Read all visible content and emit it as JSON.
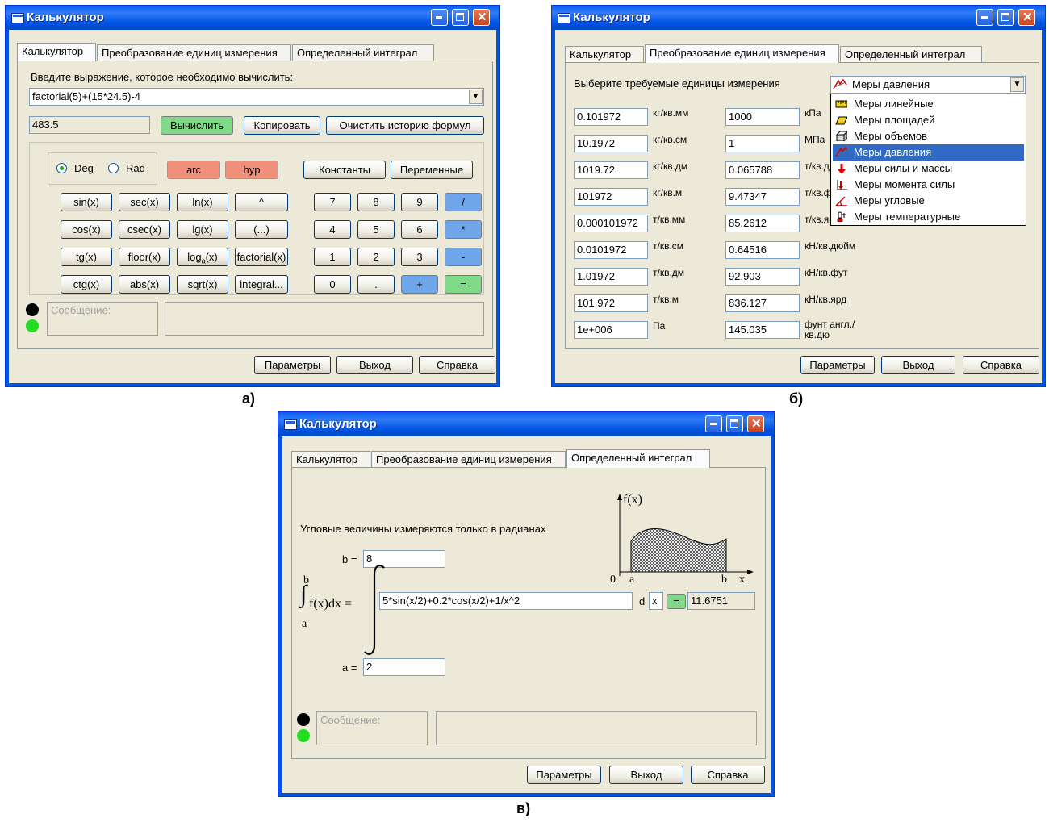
{
  "common": {
    "title": "Калькулятор",
    "tabs": [
      "Калькулятор",
      "Преобразование единиц измерения",
      "Определенный интеграл"
    ],
    "footer": [
      "Параметры",
      "Выход",
      "Справка"
    ],
    "message_placeholder": "Сообщение:",
    "colors": {
      "titlebar": "#0054e3",
      "window_bg": "#ece9d8",
      "arc_hyp": "#f0907b",
      "operator": "#6fa6ea",
      "equals": "#7fd989",
      "led_on": "#22dd22"
    }
  },
  "win_a": {
    "caption": "а)",
    "prompt": "Введите выражение, которое необходимо вычислить:",
    "expression": "factorial(5)+(15*24.5)-4",
    "result": "483.5",
    "calc_btn": "Вычислить",
    "copy_btn": "Копировать",
    "clear_btn": "Очистить историю формул",
    "deg": "Deg",
    "rad": "Rad",
    "arc": "arc",
    "hyp": "hyp",
    "constants": "Константы",
    "variables": "Переменные",
    "func_rows": [
      [
        "sin(x)",
        "sec(x)",
        "ln(x)",
        "^"
      ],
      [
        "cos(x)",
        "csec(x)",
        "lg(x)",
        "(...)"
      ],
      [
        "tg(x)",
        "floor(x)",
        "loga(x)",
        "factorial(x)"
      ],
      [
        "ctg(x)",
        "abs(x)",
        "sqrt(x)",
        "integral..."
      ]
    ],
    "num_rows": [
      [
        "7",
        "8",
        "9",
        "/"
      ],
      [
        "4",
        "5",
        "6",
        "*"
      ],
      [
        "1",
        "2",
        "3",
        "-"
      ],
      [
        "0",
        ".",
        "+",
        "="
      ]
    ]
  },
  "win_b": {
    "caption": "б)",
    "prompt": "Выберите требуемые единицы измерения",
    "combo_value": "Меры давления",
    "dropdown": [
      {
        "label": "Меры линейные",
        "icon": "ruler-icon"
      },
      {
        "label": "Меры площадей",
        "icon": "area-icon"
      },
      {
        "label": "Меры объемов",
        "icon": "cube-icon"
      },
      {
        "label": "Меры давления",
        "icon": "pressure-icon",
        "selected": true
      },
      {
        "label": "Меры силы и массы",
        "icon": "force-arrow-icon"
      },
      {
        "label": "Меры момента силы",
        "icon": "torque-icon"
      },
      {
        "label": "Меры угловые",
        "icon": "angle-icon"
      },
      {
        "label": "Меры температурные",
        "icon": "thermometer-icon"
      }
    ],
    "left_values": [
      "0.101972",
      "10.1972",
      "1019.72",
      "101972",
      "0.000101972",
      "0.0101972",
      "1.01972",
      "101.972",
      "1e+006"
    ],
    "left_units": [
      "кг/кв.мм",
      "кг/кв.см",
      "кг/кв.дм",
      "кг/кв.м",
      "т/кв.мм",
      "т/кв.см",
      "т/кв.дм",
      "т/кв.м",
      "Па"
    ],
    "right_values": [
      "1000",
      "1",
      "0.065788",
      "9.47347",
      "85.2612",
      "0.64516",
      "92.903",
      "836.127",
      "145.035"
    ],
    "right_units": [
      "кПа",
      "МПа",
      "т/кв.д",
      "т/кв.ф",
      "т/кв.я",
      "кН/кв.дюйм",
      "кН/кв.фут",
      "кН/кв.ярд",
      "фунт англ./кв.дю"
    ]
  },
  "win_c": {
    "caption": "в)",
    "note": "Угловые величины измеряются только в радианах",
    "b_label": "b =",
    "b_value": "8",
    "a_label": "a =",
    "a_value": "2",
    "integral_label": "f(x)dx =",
    "int_upper": "b",
    "int_lower": "a",
    "function": "5*sin(x/2)+0.2*cos(x/2)+1/x^2",
    "d_label": "d",
    "variable": "x",
    "eq_btn": "=",
    "result": "11.6751",
    "graph": {
      "fx": "f(x)",
      "zero": "0",
      "a": "a",
      "b": "b",
      "x": "x"
    }
  }
}
